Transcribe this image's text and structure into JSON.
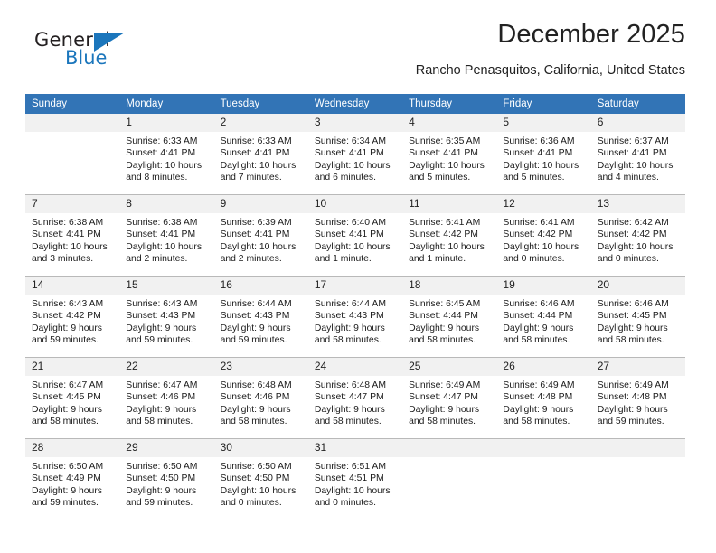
{
  "logo": {
    "word1": "General",
    "word2": "Blue",
    "triangle_color": "#1b76bc"
  },
  "header": {
    "title": "December 2025",
    "subtitle": "Rancho Penasquitos, California, United States",
    "header_bg": "#3274b6",
    "daynum_bg": "#f1f1f1"
  },
  "weekday_headers": [
    "Sunday",
    "Monday",
    "Tuesday",
    "Wednesday",
    "Thursday",
    "Friday",
    "Saturday"
  ],
  "weeks": [
    [
      {
        "day": "",
        "sunrise": "",
        "sunset": "",
        "daylight_1": "",
        "daylight_2": ""
      },
      {
        "day": "1",
        "sunrise": "Sunrise: 6:33 AM",
        "sunset": "Sunset: 4:41 PM",
        "daylight_1": "Daylight: 10 hours",
        "daylight_2": "and 8 minutes."
      },
      {
        "day": "2",
        "sunrise": "Sunrise: 6:33 AM",
        "sunset": "Sunset: 4:41 PM",
        "daylight_1": "Daylight: 10 hours",
        "daylight_2": "and 7 minutes."
      },
      {
        "day": "3",
        "sunrise": "Sunrise: 6:34 AM",
        "sunset": "Sunset: 4:41 PM",
        "daylight_1": "Daylight: 10 hours",
        "daylight_2": "and 6 minutes."
      },
      {
        "day": "4",
        "sunrise": "Sunrise: 6:35 AM",
        "sunset": "Sunset: 4:41 PM",
        "daylight_1": "Daylight: 10 hours",
        "daylight_2": "and 5 minutes."
      },
      {
        "day": "5",
        "sunrise": "Sunrise: 6:36 AM",
        "sunset": "Sunset: 4:41 PM",
        "daylight_1": "Daylight: 10 hours",
        "daylight_2": "and 5 minutes."
      },
      {
        "day": "6",
        "sunrise": "Sunrise: 6:37 AM",
        "sunset": "Sunset: 4:41 PM",
        "daylight_1": "Daylight: 10 hours",
        "daylight_2": "and 4 minutes."
      }
    ],
    [
      {
        "day": "7",
        "sunrise": "Sunrise: 6:38 AM",
        "sunset": "Sunset: 4:41 PM",
        "daylight_1": "Daylight: 10 hours",
        "daylight_2": "and 3 minutes."
      },
      {
        "day": "8",
        "sunrise": "Sunrise: 6:38 AM",
        "sunset": "Sunset: 4:41 PM",
        "daylight_1": "Daylight: 10 hours",
        "daylight_2": "and 2 minutes."
      },
      {
        "day": "9",
        "sunrise": "Sunrise: 6:39 AM",
        "sunset": "Sunset: 4:41 PM",
        "daylight_1": "Daylight: 10 hours",
        "daylight_2": "and 2 minutes."
      },
      {
        "day": "10",
        "sunrise": "Sunrise: 6:40 AM",
        "sunset": "Sunset: 4:41 PM",
        "daylight_1": "Daylight: 10 hours",
        "daylight_2": "and 1 minute."
      },
      {
        "day": "11",
        "sunrise": "Sunrise: 6:41 AM",
        "sunset": "Sunset: 4:42 PM",
        "daylight_1": "Daylight: 10 hours",
        "daylight_2": "and 1 minute."
      },
      {
        "day": "12",
        "sunrise": "Sunrise: 6:41 AM",
        "sunset": "Sunset: 4:42 PM",
        "daylight_1": "Daylight: 10 hours",
        "daylight_2": "and 0 minutes."
      },
      {
        "day": "13",
        "sunrise": "Sunrise: 6:42 AM",
        "sunset": "Sunset: 4:42 PM",
        "daylight_1": "Daylight: 10 hours",
        "daylight_2": "and 0 minutes."
      }
    ],
    [
      {
        "day": "14",
        "sunrise": "Sunrise: 6:43 AM",
        "sunset": "Sunset: 4:42 PM",
        "daylight_1": "Daylight: 9 hours",
        "daylight_2": "and 59 minutes."
      },
      {
        "day": "15",
        "sunrise": "Sunrise: 6:43 AM",
        "sunset": "Sunset: 4:43 PM",
        "daylight_1": "Daylight: 9 hours",
        "daylight_2": "and 59 minutes."
      },
      {
        "day": "16",
        "sunrise": "Sunrise: 6:44 AM",
        "sunset": "Sunset: 4:43 PM",
        "daylight_1": "Daylight: 9 hours",
        "daylight_2": "and 59 minutes."
      },
      {
        "day": "17",
        "sunrise": "Sunrise: 6:44 AM",
        "sunset": "Sunset: 4:43 PM",
        "daylight_1": "Daylight: 9 hours",
        "daylight_2": "and 58 minutes."
      },
      {
        "day": "18",
        "sunrise": "Sunrise: 6:45 AM",
        "sunset": "Sunset: 4:44 PM",
        "daylight_1": "Daylight: 9 hours",
        "daylight_2": "and 58 minutes."
      },
      {
        "day": "19",
        "sunrise": "Sunrise: 6:46 AM",
        "sunset": "Sunset: 4:44 PM",
        "daylight_1": "Daylight: 9 hours",
        "daylight_2": "and 58 minutes."
      },
      {
        "day": "20",
        "sunrise": "Sunrise: 6:46 AM",
        "sunset": "Sunset: 4:45 PM",
        "daylight_1": "Daylight: 9 hours",
        "daylight_2": "and 58 minutes."
      }
    ],
    [
      {
        "day": "21",
        "sunrise": "Sunrise: 6:47 AM",
        "sunset": "Sunset: 4:45 PM",
        "daylight_1": "Daylight: 9 hours",
        "daylight_2": "and 58 minutes."
      },
      {
        "day": "22",
        "sunrise": "Sunrise: 6:47 AM",
        "sunset": "Sunset: 4:46 PM",
        "daylight_1": "Daylight: 9 hours",
        "daylight_2": "and 58 minutes."
      },
      {
        "day": "23",
        "sunrise": "Sunrise: 6:48 AM",
        "sunset": "Sunset: 4:46 PM",
        "daylight_1": "Daylight: 9 hours",
        "daylight_2": "and 58 minutes."
      },
      {
        "day": "24",
        "sunrise": "Sunrise: 6:48 AM",
        "sunset": "Sunset: 4:47 PM",
        "daylight_1": "Daylight: 9 hours",
        "daylight_2": "and 58 minutes."
      },
      {
        "day": "25",
        "sunrise": "Sunrise: 6:49 AM",
        "sunset": "Sunset: 4:47 PM",
        "daylight_1": "Daylight: 9 hours",
        "daylight_2": "and 58 minutes."
      },
      {
        "day": "26",
        "sunrise": "Sunrise: 6:49 AM",
        "sunset": "Sunset: 4:48 PM",
        "daylight_1": "Daylight: 9 hours",
        "daylight_2": "and 58 minutes."
      },
      {
        "day": "27",
        "sunrise": "Sunrise: 6:49 AM",
        "sunset": "Sunset: 4:48 PM",
        "daylight_1": "Daylight: 9 hours",
        "daylight_2": "and 59 minutes."
      }
    ],
    [
      {
        "day": "28",
        "sunrise": "Sunrise: 6:50 AM",
        "sunset": "Sunset: 4:49 PM",
        "daylight_1": "Daylight: 9 hours",
        "daylight_2": "and 59 minutes."
      },
      {
        "day": "29",
        "sunrise": "Sunrise: 6:50 AM",
        "sunset": "Sunset: 4:50 PM",
        "daylight_1": "Daylight: 9 hours",
        "daylight_2": "and 59 minutes."
      },
      {
        "day": "30",
        "sunrise": "Sunrise: 6:50 AM",
        "sunset": "Sunset: 4:50 PM",
        "daylight_1": "Daylight: 10 hours",
        "daylight_2": "and 0 minutes."
      },
      {
        "day": "31",
        "sunrise": "Sunrise: 6:51 AM",
        "sunset": "Sunset: 4:51 PM",
        "daylight_1": "Daylight: 10 hours",
        "daylight_2": "and 0 minutes."
      },
      {
        "day": "",
        "sunrise": "",
        "sunset": "",
        "daylight_1": "",
        "daylight_2": ""
      },
      {
        "day": "",
        "sunrise": "",
        "sunset": "",
        "daylight_1": "",
        "daylight_2": ""
      },
      {
        "day": "",
        "sunrise": "",
        "sunset": "",
        "daylight_1": "",
        "daylight_2": ""
      }
    ]
  ]
}
